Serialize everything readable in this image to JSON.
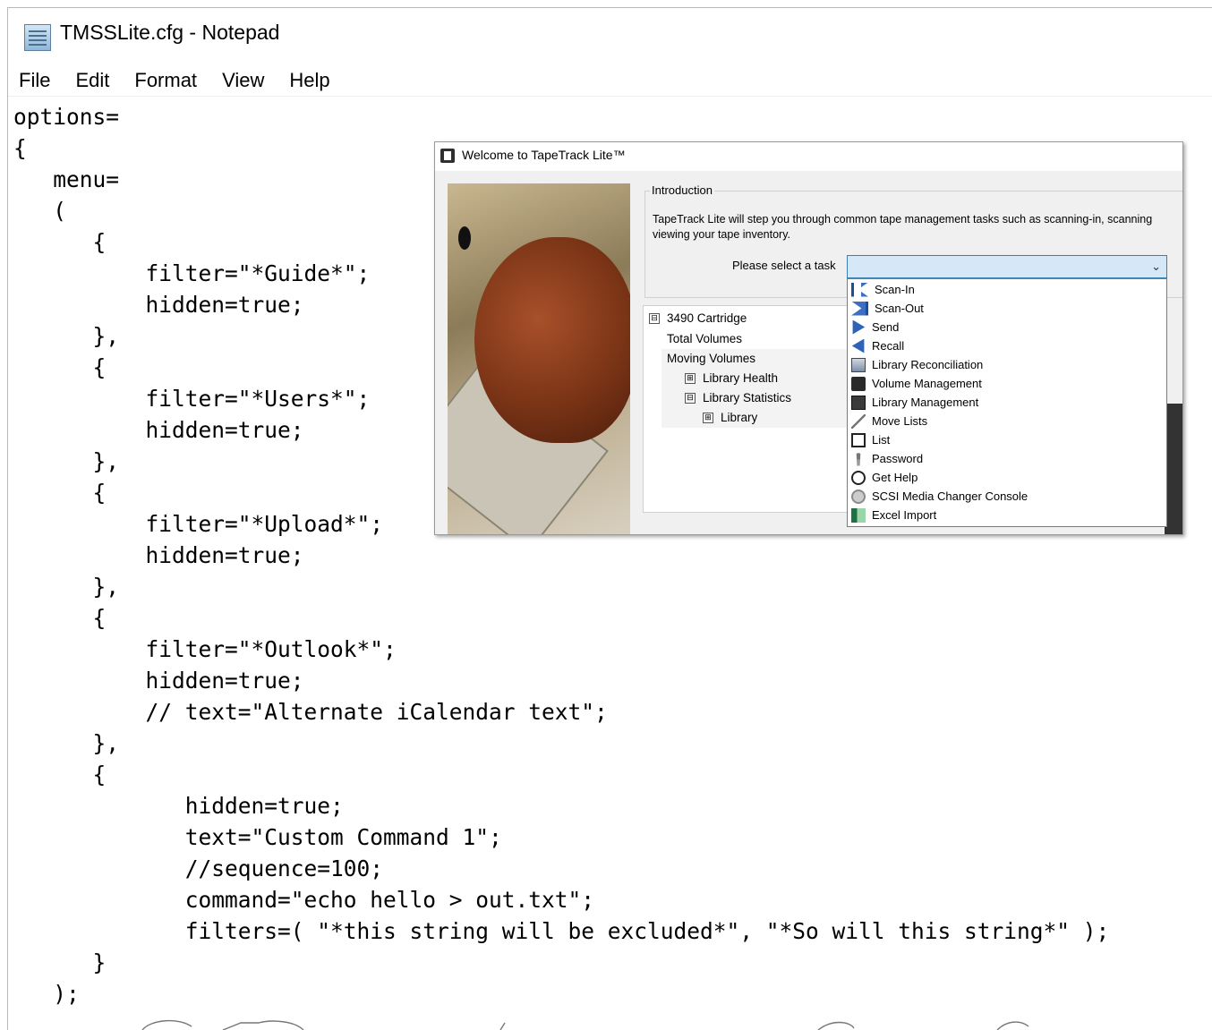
{
  "window": {
    "title": "TMSSLite.cfg - Notepad",
    "icon": "notepad-icon"
  },
  "menu": [
    {
      "label": "File"
    },
    {
      "label": "Edit"
    },
    {
      "label": "Format"
    },
    {
      "label": "View"
    },
    {
      "label": "Help"
    }
  ],
  "editor": {
    "lines": [
      "options=",
      "{",
      "   menu=",
      "   (",
      "      {",
      "          filter=\"*Guide*\";",
      "          hidden=true;",
      "      },",
      "      {",
      "          filter=\"*Users*\";",
      "          hidden=true;",
      "      },",
      "      {",
      "          filter=\"*Upload*\";",
      "          hidden=true;",
      "      },",
      "      {",
      "          filter=\"*Outlook*\";",
      "          hidden=true;",
      "          // text=\"Alternate iCalendar text\";",
      "      },",
      "      {",
      "             hidden=true;",
      "             text=\"Custom Command 1\";",
      "             //sequence=100;",
      "             command=\"echo hello > out.txt\";",
      "             filters=( \"*this string will be excluded*\", \"*So will this string*\" );",
      "      }",
      "   );"
    ]
  },
  "dialog": {
    "title": "Welcome to TapeTrack Lite™",
    "group_label": "Introduction",
    "intro_line1": "TapeTrack Lite will step you through common tape management tasks such as scanning-in, scanning",
    "intro_line2": "viewing your tape inventory.",
    "task_label": "Please select a task",
    "task_options": [
      {
        "label": "Scan-In",
        "icon": "scan-in-icon"
      },
      {
        "label": "Scan-Out",
        "icon": "scan-out-icon"
      },
      {
        "label": "Send",
        "icon": "send-icon"
      },
      {
        "label": "Recall",
        "icon": "recall-icon"
      },
      {
        "label": "Library Reconciliation",
        "icon": "library-reconciliation-icon"
      },
      {
        "label": "Volume Management",
        "icon": "volume-management-icon"
      },
      {
        "label": "Library Management",
        "icon": "library-management-icon"
      },
      {
        "label": "Move Lists",
        "icon": "move-lists-icon"
      },
      {
        "label": "List",
        "icon": "list-icon"
      },
      {
        "label": "Password",
        "icon": "password-icon"
      },
      {
        "label": "Get Help",
        "icon": "get-help-icon"
      },
      {
        "label": "SCSI Media Changer Console",
        "icon": "scsi-console-icon"
      },
      {
        "label": "Excel Import",
        "icon": "excel-import-icon"
      }
    ],
    "tree": [
      {
        "label": "3490 Cartridge",
        "toggle": "⊟"
      },
      {
        "label": "Total Volumes"
      },
      {
        "label": "Moving Volumes"
      },
      {
        "label": "Library Health",
        "toggle": "⊞"
      },
      {
        "label": "Library Statistics",
        "toggle": "⊟"
      },
      {
        "label": "Library",
        "toggle": "⊞"
      }
    ]
  }
}
